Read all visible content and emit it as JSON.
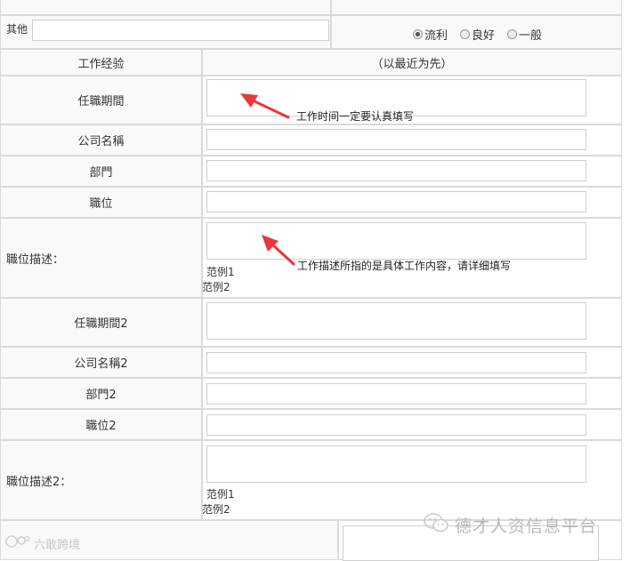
{
  "form": {
    "other_label": "其他",
    "other_value": "",
    "fluency": {
      "options": [
        "流利",
        "良好",
        "一般"
      ],
      "selected": "流利"
    },
    "work_header_left": "工作经验",
    "work_header_right": "（以最近为先）",
    "period_label": "任職期間",
    "company_label": "公司名稱",
    "dept_label": "部門",
    "position_label": "職位",
    "desc_label": "職位描述：",
    "example1": "范例1",
    "example2": "范例2",
    "period2_label": "任職期間2",
    "company2_label": "公司名稱2",
    "dept2_label": "部門2",
    "position2_label": "職位2",
    "desc2_label": "職位描述2：",
    "example1_b": "范例1",
    "example2_b": "范例2"
  },
  "annotations": {
    "note1": "工作时间一定要认真填写",
    "note2": "工作描述所指的是具体工作内容，请详细填写",
    "arrow_color": "#e8383b"
  },
  "watermarks": {
    "brand": "德才人资信息平台",
    "left": "六敢跨境"
  }
}
